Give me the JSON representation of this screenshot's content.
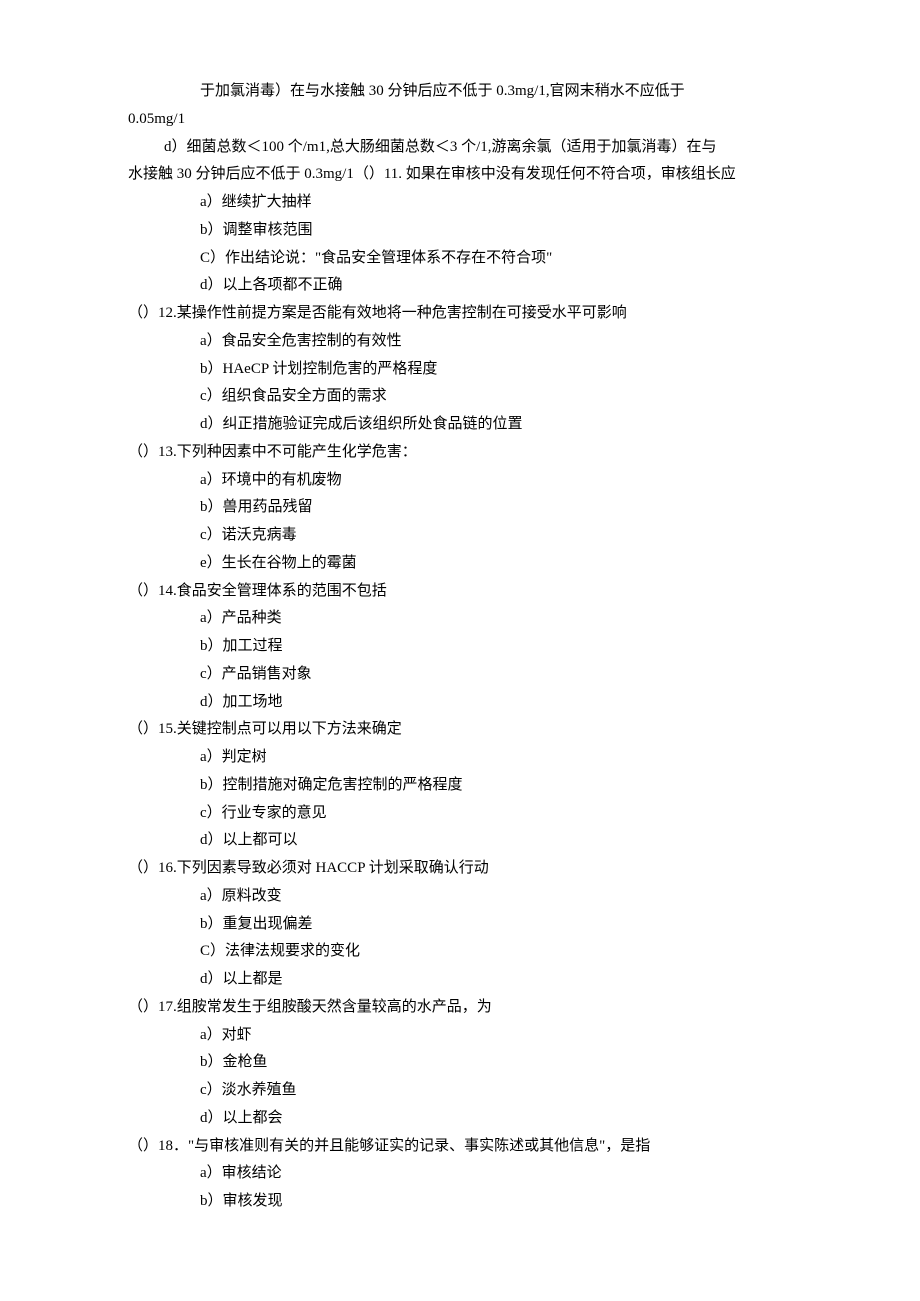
{
  "lines": [
    {
      "indent": 2,
      "prefix": "",
      "text": "于加氯消毒）在与水接触 30 分钟后应不低于 0.3mg/1,官网末稍水不应低于"
    },
    {
      "indent": 0,
      "prefix": "",
      "text": "0.05mg/1"
    },
    {
      "indent": 1,
      "prefix": "d）",
      "text": "细菌总数＜100 个/m1,总大肠细菌总数＜3 个/1,游离余氯（适用于加氯消毒）在与"
    },
    {
      "indent": 0,
      "prefix": "",
      "text": "水接触 30 分钟后应不低于 0.3mg/1（）11. 如果在审核中没有发现任何不符合项，审核组长应"
    },
    {
      "indent": 2,
      "prefix": "a）",
      "text": "继续扩大抽样"
    },
    {
      "indent": 2,
      "prefix": "b）",
      "text": "调整审核范围"
    },
    {
      "indent": 2,
      "prefix": "C）",
      "text": "作出结论说：\"食品安全管理体系不存在不符合项\""
    },
    {
      "indent": 2,
      "prefix": "d）",
      "text": "以上各项都不正确"
    },
    {
      "indent": 0,
      "prefix": "（）12.",
      "text": "某操作性前提方案是否能有效地将一种危害控制在可接受水平可影响"
    },
    {
      "indent": 2,
      "prefix": "a）",
      "text": "食品安全危害控制的有效性"
    },
    {
      "indent": 2,
      "prefix": "b）",
      "text": "HAeCP 计划控制危害的严格程度"
    },
    {
      "indent": 2,
      "prefix": "c）",
      "text": "组织食品安全方面的需求"
    },
    {
      "indent": 2,
      "prefix": "d）",
      "text": "纠正措施验证完成后该组织所处食品链的位置"
    },
    {
      "indent": 0,
      "prefix": "（）13.",
      "text": "下列种因素中不可能产生化学危害："
    },
    {
      "indent": 2,
      "prefix": "a）",
      "text": "环境中的有机废物"
    },
    {
      "indent": 2,
      "prefix": "b）",
      "text": "兽用药品残留"
    },
    {
      "indent": 2,
      "prefix": "c）",
      "text": "诺沃克病毒"
    },
    {
      "indent": 2,
      "prefix": "e）",
      "text": "生长在谷物上的霉菌"
    },
    {
      "indent": 0,
      "prefix": "（）14.",
      "text": "食品安全管理体系的范围不包括"
    },
    {
      "indent": 2,
      "prefix": "a）",
      "text": "产品种类"
    },
    {
      "indent": 2,
      "prefix": "b）",
      "text": "加工过程"
    },
    {
      "indent": 2,
      "prefix": "c）",
      "text": "产品销售对象"
    },
    {
      "indent": 2,
      "prefix": "d）",
      "text": "加工场地"
    },
    {
      "indent": 0,
      "prefix": "（）15.",
      "text": "关键控制点可以用以下方法来确定"
    },
    {
      "indent": 2,
      "prefix": "a）",
      "text": "判定树"
    },
    {
      "indent": 2,
      "prefix": "b）",
      "text": "控制措施对确定危害控制的严格程度"
    },
    {
      "indent": 2,
      "prefix": "c）",
      "text": "行业专家的意见"
    },
    {
      "indent": 2,
      "prefix": "d）",
      "text": "以上都可以"
    },
    {
      "indent": 0,
      "prefix": "（）16.",
      "text": "下列因素导致必须对 HACCP 计划采取确认行动"
    },
    {
      "indent": 2,
      "prefix": "a）",
      "text": "原料改变"
    },
    {
      "indent": 2,
      "prefix": "b）",
      "text": "重复出现偏差"
    },
    {
      "indent": 2,
      "prefix": "C）",
      "text": "法律法规要求的变化"
    },
    {
      "indent": 2,
      "prefix": "d）",
      "text": "以上都是"
    },
    {
      "indent": 0,
      "prefix": "（）17.",
      "text": "组胺常发生于组胺酸天然含量较高的水产品，为"
    },
    {
      "indent": 2,
      "prefix": "a）",
      "text": "对虾"
    },
    {
      "indent": 2,
      "prefix": "b）",
      "text": "金枪鱼"
    },
    {
      "indent": 2,
      "prefix": "c）",
      "text": "淡水养殖鱼"
    },
    {
      "indent": 2,
      "prefix": "d）",
      "text": "以上都会"
    },
    {
      "indent": 0,
      "prefix": "（）18．",
      "text": "\"与审核准则有关的并且能够证实的记录、事实陈述或其他信息\"，是指"
    },
    {
      "indent": 2,
      "prefix": "a）",
      "text": "审核结论"
    },
    {
      "indent": 2,
      "prefix": "b）",
      "text": "审核发现"
    }
  ]
}
